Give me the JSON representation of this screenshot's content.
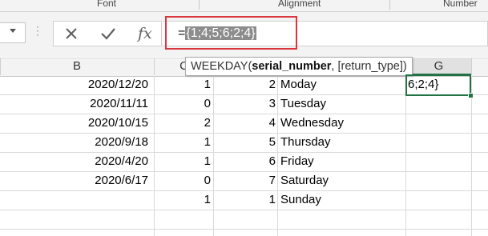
{
  "ribbon": {
    "groups": [
      "Font",
      "Alignment",
      "Number"
    ]
  },
  "formula_bar": {
    "cancel_icon": "x-icon",
    "enter_icon": "checkmark-icon",
    "function_icon": "fx-icon",
    "fx_label": "fx",
    "formula_prefix": "=",
    "formula_selected": "{1;4;5;6;2;4}",
    "highlight_color": "#d9363e"
  },
  "tooltip": {
    "function_name": "WEEKDAY(",
    "bold_arg": "serial_number",
    "rest": ", [return_type])"
  },
  "columns": [
    "B",
    "C",
    "G"
  ],
  "rows": [
    {
      "date": "2020/12/20",
      "c": "1",
      "d": "2",
      "e": "Moday"
    },
    {
      "date": "2020/11/11",
      "c": "0",
      "d": "3",
      "e": "Tuesday"
    },
    {
      "date": "2020/10/15",
      "c": "2",
      "d": "4",
      "e": "Wednesday"
    },
    {
      "date": "2020/9/18",
      "c": "1",
      "d": "5",
      "e": "Thursday"
    },
    {
      "date": "2020/4/20",
      "c": "1",
      "d": "6",
      "e": "Friday"
    },
    {
      "date": "2020/6/17",
      "c": "0",
      "d": "7",
      "e": "Saturday"
    },
    {
      "date": "",
      "c": "1",
      "d": "1",
      "e": "Sunday"
    }
  ],
  "selected_cell": {
    "value": "6;2;4}",
    "accent_color": "#217346"
  }
}
